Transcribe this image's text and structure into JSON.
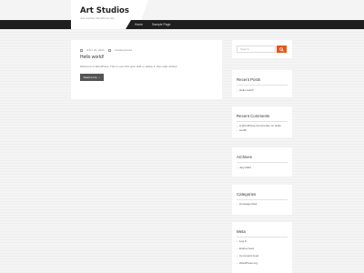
{
  "site": {
    "title": "Art Studios",
    "tagline": "Just another WordPress site"
  },
  "nav": {
    "items": [
      {
        "label": "Home"
      },
      {
        "label": "Sample Page"
      }
    ]
  },
  "post": {
    "date": "JULY 23, 2024",
    "category": "Uncategorized",
    "title": "Hello world!",
    "excerpt": "Welcome to WordPress. This is your first post. Edit or delete it, then start writing!",
    "read_more": "Read more →"
  },
  "sidebar": {
    "search_placeholder": "Search ...",
    "recent_posts": {
      "title": "Recent Posts",
      "items": [
        "Hello world!"
      ]
    },
    "recent_comments": {
      "title": "Recent Comments",
      "items": [
        "A WordPress Commenter on Hello",
        "world!"
      ]
    },
    "archives": {
      "title": "Archives",
      "items": [
        "July 2024"
      ]
    },
    "categories": {
      "title": "Categories",
      "items": [
        "Uncategorized"
      ]
    },
    "meta": {
      "title": "Meta",
      "items": [
        "Log in",
        "Entries feed",
        "Comments feed",
        "WordPress.org"
      ]
    }
  },
  "colors": {
    "accent": "#e8571b",
    "navbar": "#1f1f1f",
    "button": "#555555"
  }
}
